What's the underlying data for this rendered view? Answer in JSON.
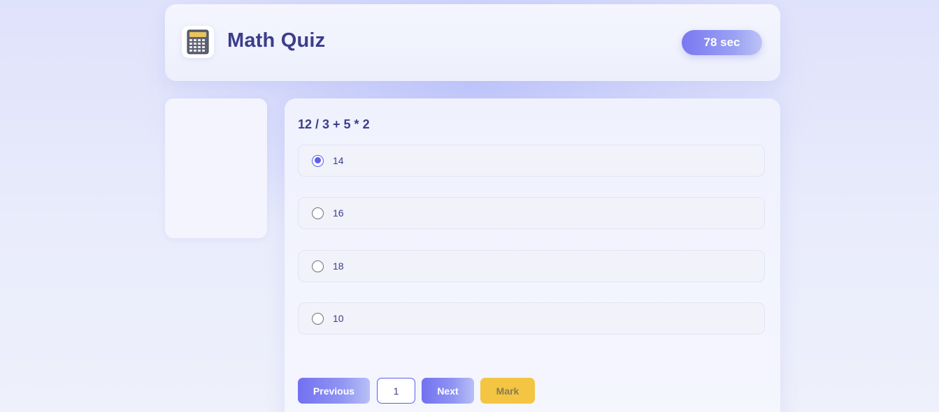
{
  "header": {
    "logo_icon": "calculator-icon",
    "title": "Math Quiz",
    "timer": "78 sec"
  },
  "question": {
    "text": "12 / 3 + 5 * 2",
    "options": [
      {
        "label": "14",
        "selected": true
      },
      {
        "label": "16",
        "selected": false
      },
      {
        "label": "18",
        "selected": false
      },
      {
        "label": "10",
        "selected": false
      }
    ]
  },
  "nav": {
    "previous_label": "Previous",
    "page_number": "1",
    "next_label": "Next",
    "mark_label": "Mark"
  },
  "colors": {
    "accent": "#5b5ef0",
    "title_text": "#3b3d8c",
    "mark_button": "#f4c542"
  }
}
